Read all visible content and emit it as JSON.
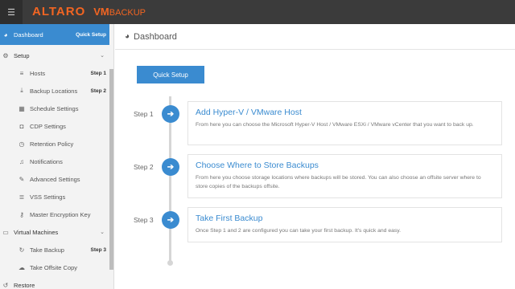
{
  "topbar": {
    "menu_icon": "☰",
    "brand": "ALTARO",
    "product_vm": "VM",
    "product_name": "BACKUP"
  },
  "sidebar": {
    "dashboard": {
      "label": "Dashboard",
      "badge": "Quick Setup"
    },
    "setup": "Setup",
    "setup_items": [
      {
        "label": "Hosts",
        "step": "Step 1"
      },
      {
        "label": "Backup Locations",
        "step": "Step 2"
      },
      {
        "label": "Schedule Settings"
      },
      {
        "label": "CDP Settings"
      },
      {
        "label": "Retention Policy"
      },
      {
        "label": "Notifications"
      },
      {
        "label": "Advanced Settings"
      },
      {
        "label": "VSS Settings"
      },
      {
        "label": "Master Encryption Key"
      }
    ],
    "virtual_machines": "Virtual Machines",
    "vm_items": [
      {
        "label": "Take Backup",
        "step": "Step 3"
      },
      {
        "label": "Take Offsite Copy"
      }
    ],
    "restore": "Restore"
  },
  "main": {
    "header": "Dashboard",
    "quick_setup_button": "Quick Setup",
    "steps": [
      {
        "label": "Step 1",
        "title": "Add Hyper-V / VMware Host",
        "desc": "From here you can choose the Microsoft Hyper-V Host / VMware ESXi / VMware vCenter that you want to back up."
      },
      {
        "label": "Step 2",
        "title": "Choose Where to Store Backups",
        "desc": "From here you choose storage locations where backups will be stored. You can also choose an offsite server where to store copies of the backups offsite."
      },
      {
        "label": "Step 3",
        "title": "Take First Backup",
        "desc": "Once Step 1 and 2 are configured you can take your first backup. It's quick and easy."
      }
    ]
  },
  "colors": {
    "accent": "#3a8bd0",
    "brand": "#f26522",
    "topbar": "#3b3b3b"
  }
}
